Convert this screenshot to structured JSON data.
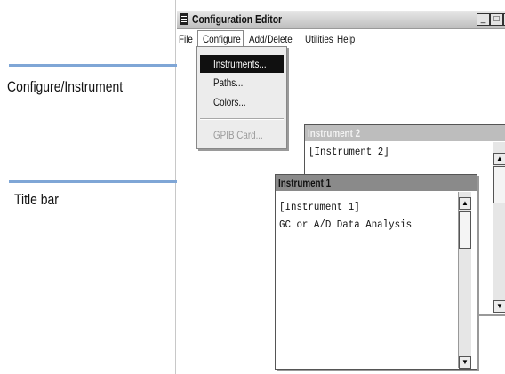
{
  "callouts": [
    {
      "label": "Configure/Instrument"
    },
    {
      "label": "Title bar"
    }
  ],
  "window": {
    "title": "Configuration Editor",
    "controls": {
      "minimize": "_",
      "maximize": "□",
      "close": "x"
    }
  },
  "menubar": {
    "items": [
      "File",
      "Configure",
      "Add/Delete",
      "Utilities",
      "Help"
    ]
  },
  "configure_menu": {
    "items": [
      {
        "label": "Instruments...",
        "state": "selected"
      },
      {
        "label": "Paths...",
        "state": "normal"
      },
      {
        "label": "Colors...",
        "state": "normal"
      },
      {
        "label": "GPIB Card...",
        "state": "disabled"
      }
    ]
  },
  "instrument2": {
    "title": "Instrument 2",
    "lines": [
      "[Instrument 2]"
    ]
  },
  "instrument1": {
    "title": "Instrument 1",
    "lines": [
      "[Instrument 1]",
      "GC or A/D Data Analysis"
    ]
  },
  "colors": {
    "callout_line": "#7fa6d6",
    "active_title": "#8a8a8a",
    "inactive_title": "#bdbdbd",
    "selection": "#101010"
  }
}
